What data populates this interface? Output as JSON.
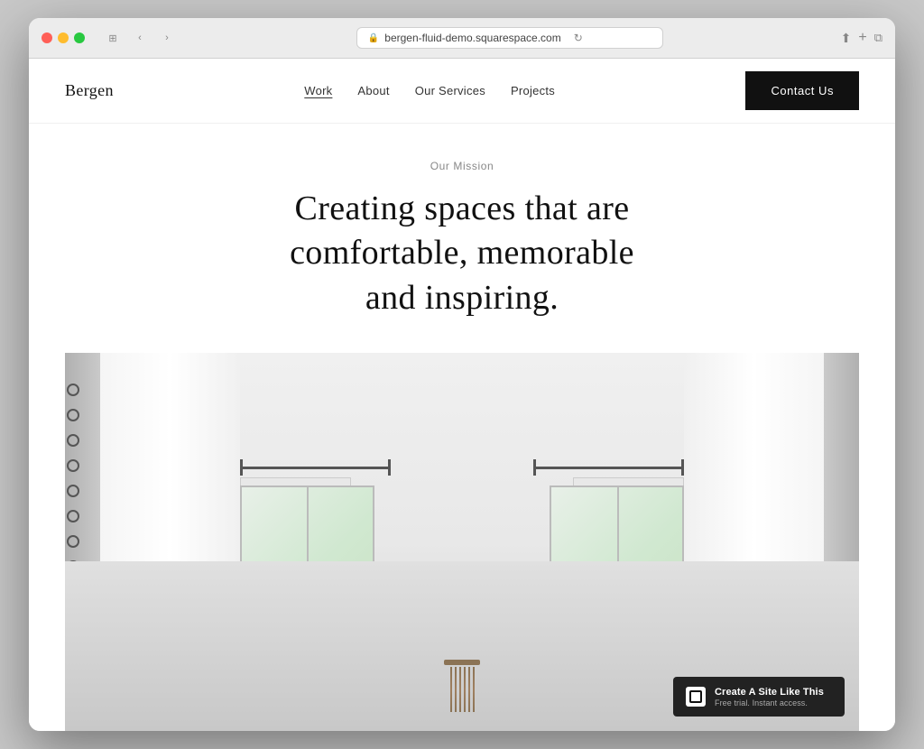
{
  "browser": {
    "url": "bergen-fluid-demo.squarespace.com",
    "back_label": "‹",
    "forward_label": "›",
    "reload_label": "↻",
    "share_label": "⬆",
    "new_tab_label": "+",
    "windows_label": "⧉"
  },
  "nav": {
    "logo": "Bergen",
    "links": [
      {
        "label": "Work",
        "active": true
      },
      {
        "label": "About",
        "active": false
      },
      {
        "label": "Our Services",
        "active": false
      },
      {
        "label": "Projects",
        "active": false
      }
    ],
    "cta": "Contact Us"
  },
  "mission": {
    "label": "Our Mission",
    "heading": "Creating spaces that are comfortable, memorable and inspiring."
  },
  "badge": {
    "title": "Create A Site Like This",
    "subtitle": "Free trial. Instant access."
  }
}
